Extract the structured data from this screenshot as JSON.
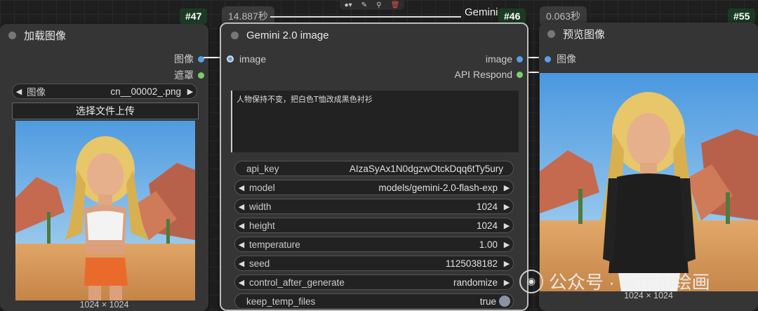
{
  "load_node": {
    "title": "加载图像",
    "badge": "#47",
    "outputs": [
      "图像",
      "遮罩"
    ],
    "image_widget": {
      "label": "图像",
      "value": "cn__00002_.png"
    },
    "upload_label": "选择文件上传",
    "size_caption": "1024 × 1024"
  },
  "gemini_node": {
    "title": "Gemini 2.0 image",
    "badge": "#46",
    "time": "14.887秒",
    "header_title_fragment": "Gemini",
    "input": "image",
    "outputs": [
      "image",
      "API Respond"
    ],
    "prompt": "人物保持不变，把白色T恤改成黑色衬衫",
    "widgets": [
      {
        "label": "api_key",
        "value": "AIzaSyAx1N0dgzwOtckDqq6tTy5ury",
        "arrows": false
      },
      {
        "label": "model",
        "value": "models/gemini-2.0-flash-exp",
        "arrows": true
      },
      {
        "label": "width",
        "value": "1024",
        "arrows": true
      },
      {
        "label": "height",
        "value": "1024",
        "arrows": true
      },
      {
        "label": "temperature",
        "value": "1.00",
        "arrows": true
      },
      {
        "label": "seed",
        "value": "1125038182",
        "arrows": true
      },
      {
        "label": "control_after_generate",
        "value": "randomize",
        "arrows": true
      },
      {
        "label": "keep_temp_files",
        "value": "true",
        "arrows": false
      }
    ]
  },
  "preview_node": {
    "title": "预览图像",
    "badge": "#55",
    "time": "0.063秒",
    "input": "图像",
    "size_caption": "1024 × 1024"
  },
  "watermark": {
    "text": "公众号 · 听雨AI绘画"
  },
  "toolbar_icons": [
    "color-dot-icon",
    "pin-icon",
    "bookmark-icon",
    "trash-icon"
  ],
  "colors": {
    "image_socket": "#5aa0e6",
    "mask_socket": "#7bcf6c",
    "badge_bg": "#1b3a23",
    "trash": "#e05050"
  }
}
